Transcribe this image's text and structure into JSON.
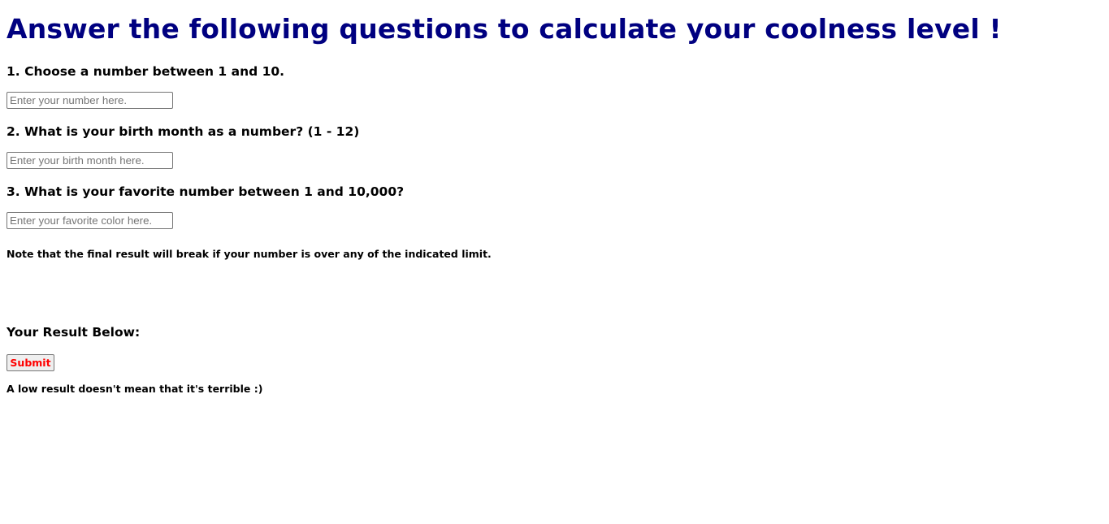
{
  "heading": "Answer the following questions to calculate your coolness level !",
  "questions": [
    {
      "label": "1. Choose a number between 1 and 10.",
      "placeholder": "Enter your number here.",
      "value": ""
    },
    {
      "label": "2. What is your birth month as a number? (1 - 12)",
      "placeholder": "Enter your birth month here.",
      "value": ""
    },
    {
      "label": "3. What is your favorite number between 1 and 10,000?",
      "placeholder": "Enter your favorite color here.",
      "value": ""
    }
  ],
  "note": "Note that the final result will break if your number is over any of the indicated limit.",
  "result": {
    "label": "Your Result Below:",
    "submit_label": "Submit",
    "footnote": "A low result doesn't mean that it's terrible :)"
  },
  "colors": {
    "heading": "#000080",
    "submit_text": "#ff0000"
  }
}
